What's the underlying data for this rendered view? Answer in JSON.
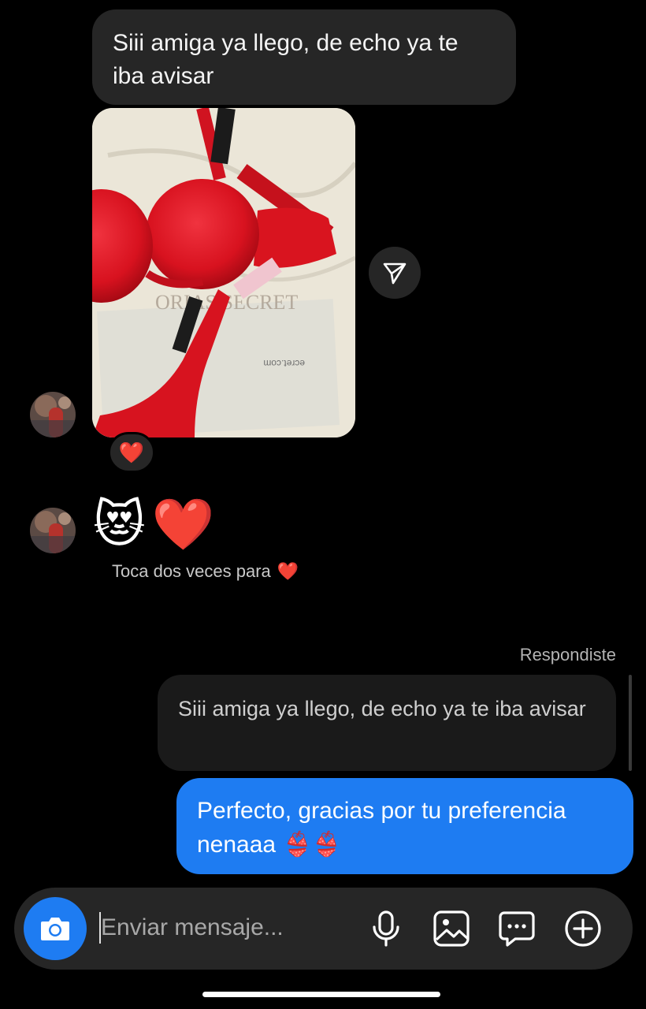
{
  "thread": {
    "incoming_text": "Siii amiga ya llego, de echo ya te iba avisar",
    "photo_reaction": "❤️",
    "emojis": [
      "😻",
      "❤️"
    ],
    "double_tap_hint": "Toca dos veces para",
    "double_tap_icon": "❤️"
  },
  "reply": {
    "replied_label": "Respondiste",
    "quoted_text": "Siii amiga ya llego, de echo ya te iba avisar",
    "outgoing_text": "Perfecto, gracias por tu preferencia nenaaa 👙👙"
  },
  "composer": {
    "placeholder": "Enviar mensaje...",
    "icons": [
      "camera-icon",
      "microphone-icon",
      "gallery-icon",
      "sticker-icon",
      "plus-icon"
    ]
  },
  "colors": {
    "background": "#000000",
    "incoming_bubble": "#262626",
    "outgoing_bubble": "#1e7cf2",
    "accent": "#1e7cf2"
  }
}
